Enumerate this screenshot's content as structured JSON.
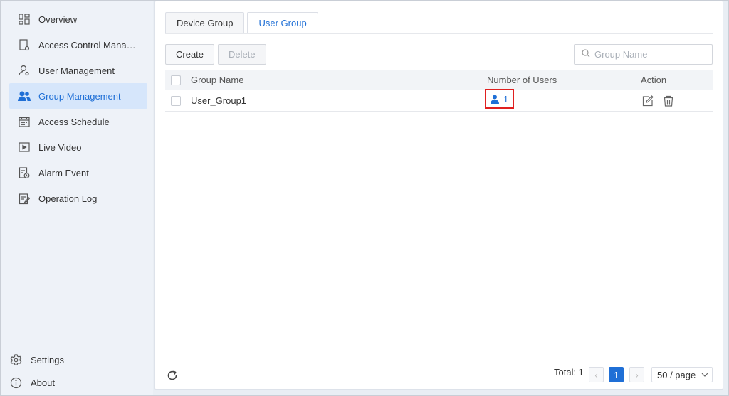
{
  "sidebar": {
    "items": [
      {
        "label": "Overview",
        "icon": "overview-icon"
      },
      {
        "label": "Access Control Manag...",
        "icon": "access-control-icon"
      },
      {
        "label": "User Management",
        "icon": "user-icon"
      },
      {
        "label": "Group Management",
        "icon": "group-icon"
      },
      {
        "label": "Access Schedule",
        "icon": "calendar-icon"
      },
      {
        "label": "Live Video",
        "icon": "video-icon"
      },
      {
        "label": "Alarm Event",
        "icon": "alarm-icon"
      },
      {
        "label": "Operation Log",
        "icon": "log-icon"
      }
    ],
    "settings_label": "Settings",
    "about_label": "About"
  },
  "tabs": {
    "device_group": "Device Group",
    "user_group": "User Group"
  },
  "toolbar": {
    "create_label": "Create",
    "delete_label": "Delete",
    "search_placeholder": "Group Name"
  },
  "table": {
    "headers": {
      "group_name": "Group Name",
      "number_of_users": "Number of Users",
      "action": "Action"
    },
    "rows": [
      {
        "group_name": "User_Group1",
        "number_of_users": "1"
      }
    ]
  },
  "pagination": {
    "total_label": "Total: 1",
    "current_page": "1",
    "page_size": "50 / page"
  },
  "colors": {
    "accent": "#1f6fd6",
    "highlight_box": "#e02020",
    "sidebar_bg": "#eef2f8",
    "active_item_bg": "#d6e6fb"
  }
}
